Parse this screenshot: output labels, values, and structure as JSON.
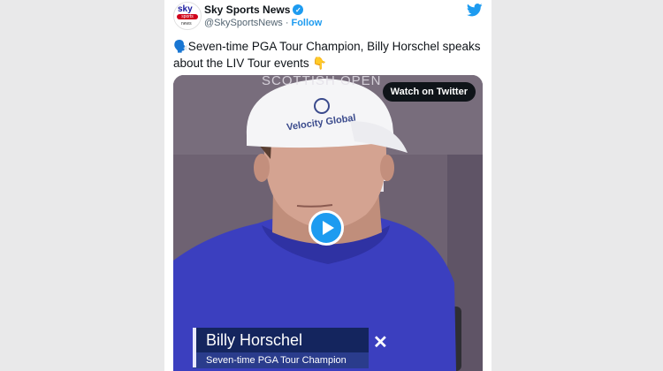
{
  "author": {
    "name": "Sky Sports News",
    "handle": "@SkySportsNews",
    "follow_label": "Follow",
    "verified": true,
    "avatar_text": {
      "line1": "sky",
      "line2": "sports",
      "line3": "news"
    }
  },
  "tweet": {
    "text": "🗣️Seven-time PGA Tour Champion, Billy Horschel speaks about the LIV Tour events 👇"
  },
  "video": {
    "watch_label": "Watch on Twitter",
    "backdrop_text": "SCOTTISH OPEN",
    "hat_logo": "Velocity Global",
    "lower_third": {
      "name": "Billy Horschel",
      "title": "Seven-time PGA Tour Champion"
    }
  },
  "colors": {
    "brand_blue": "#1d9bf0",
    "text": "#0f1419",
    "secondary": "#536471",
    "lower_third_dark": "#14255e"
  },
  "icons": {
    "twitter": "twitter-bird-icon",
    "verified": "verified-badge-icon",
    "play": "play-icon"
  }
}
